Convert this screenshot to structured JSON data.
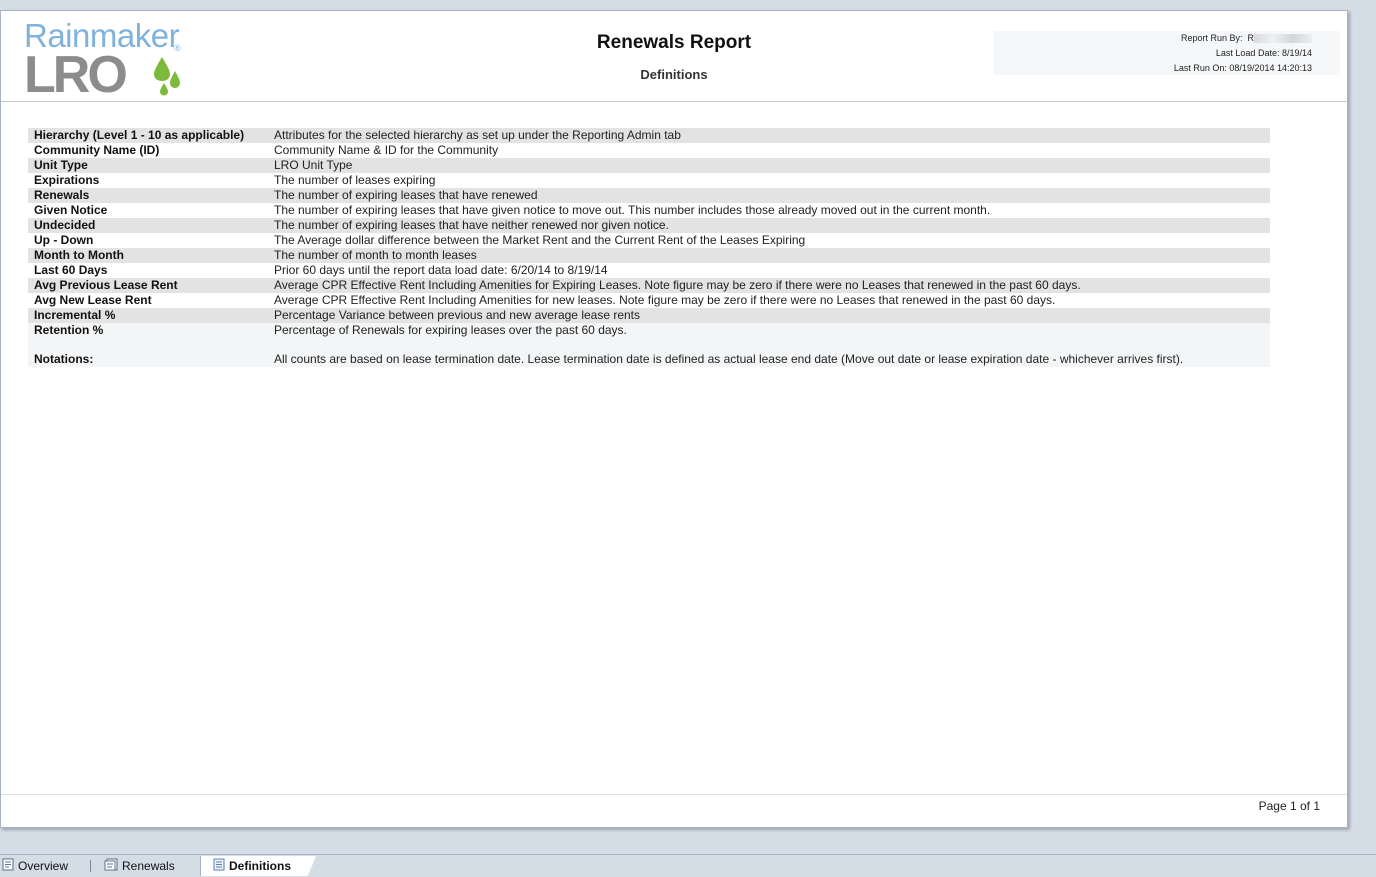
{
  "header": {
    "logo_top": "Rainmaker",
    "logo_bottom": "LRO",
    "logo_reg": "®",
    "title": "Renewals Report",
    "subtitle": "Definitions",
    "run_by_label": "Report Run By:",
    "run_by_value": "R",
    "last_load_label": "Last Load Date:",
    "last_load_value": "8/19/14",
    "last_run_label": "Last Run On:",
    "last_run_value": "08/19/2014 14:20:13"
  },
  "definitions": [
    {
      "term": "Hierarchy (Level 1 - 10 as applicable)",
      "desc": "Attributes for the selected hierarchy as set up under the Reporting Admin tab"
    },
    {
      "term": "Community Name (ID)",
      "desc": "Community Name & ID for the Community"
    },
    {
      "term": "Unit Type",
      "desc": "LRO Unit Type"
    },
    {
      "term": "Expirations",
      "desc": "The number of leases expiring"
    },
    {
      "term": "Renewals",
      "desc": "The number of expiring leases that have renewed"
    },
    {
      "term": "Given Notice",
      "desc": "The number of expiring leases that have given notice to move out. This number includes those already moved out in the current month."
    },
    {
      "term": "Undecided",
      "desc": "The number of expiring leases that have neither renewed nor given notice."
    },
    {
      "term": "Up - Down",
      "desc": "The Average dollar difference between the Market Rent and the Current Rent of the Leases Expiring"
    },
    {
      "term": "Month to Month",
      "desc": "The number of month to month leases"
    },
    {
      "term": "Last 60 Days",
      "desc": "Prior 60 days until the report data load date: 6/20/14 to 8/19/14"
    },
    {
      "term": "Avg Previous Lease Rent",
      "desc": "Average CPR Effective Rent Including Amenities for Expiring Leases. Note figure may be zero if there were no Leases that renewed in the past 60 days."
    },
    {
      "term": "Avg New Lease Rent",
      "desc": "Average CPR Effective Rent Including Amenities for new leases.  Note figure may be zero if there were no Leases that renewed in the past 60 days."
    },
    {
      "term": "Incremental %",
      "desc": "Percentage Variance between previous and new average lease rents"
    },
    {
      "term": "Retention %",
      "desc": "Percentage of Renewals for expiring leases over the past 60 days."
    }
  ],
  "notations": {
    "term": "Notations:",
    "desc": "All counts are based on lease termination date. Lease termination date is defined as actual lease end date (Move out date or lease expiration date -  whichever arrives first)."
  },
  "footer": {
    "page": "Page 1 of 1"
  },
  "tabs": [
    {
      "label": "Overview",
      "icon": "report-page-icon"
    },
    {
      "label": "Renewals",
      "icon": "report-page-icon"
    },
    {
      "label": "Definitions",
      "icon": "document-icon",
      "active": true
    }
  ],
  "colors": {
    "logo_blue": "#7fb2dd",
    "logo_gray": "#8c8c8c",
    "logo_green": "#7dba3a",
    "row_shade": "#e3e3e3"
  }
}
